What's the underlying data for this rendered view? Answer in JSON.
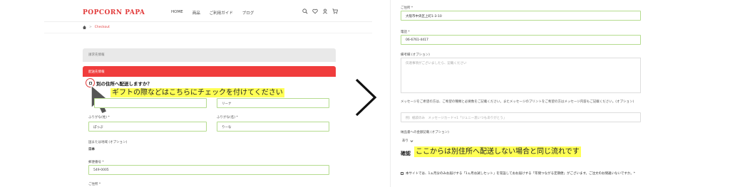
{
  "left": {
    "logo": "POPCORN PAPA",
    "nav": [
      "HOME",
      "商品",
      "ご利用ガイド",
      "ブログ"
    ],
    "breadcrumb": {
      "separator": ">",
      "current": "Checkout"
    },
    "section_customer": "請求先情報",
    "section_shipping": "配送先情報",
    "ship_diff_label": "別の住所へ配送しますか？",
    "callout": "ギフトの際などはこちらにチェックを付けてください",
    "fields": {
      "last_name_value": "",
      "first_name_value": "リーナ",
      "last_kana_label": "ふりがな(姓) *",
      "last_kana_value": "ぽっぷ",
      "first_kana_label": "ふりがな(名) *",
      "first_kana_value": "りーな",
      "country_label": "国または地域 (オプション)",
      "country_value": "日本",
      "postal_label": "郵便番号 *",
      "postal_value": "549-0005",
      "address_label": "ご住所 *"
    }
  },
  "right": {
    "address_label": "ご住所 *",
    "address_value": "大阪市中央区上町1-3-10",
    "phone_label": "電話 *",
    "phone_value": "06-6761-4417",
    "notes_label": "備考欄 (オプション)",
    "notes_placeholder": "伝達事項がございましたら、記載ください",
    "message_label": "メッセージをご希望の方は、ご希望の種類と必要数をご記載ください。またメッセージのプリントをご希望の方はメッセージ内容もご記載ください。(オプション)",
    "message_placeholder": "例）紙袋のみ　メッセージカード+1「ジュニー思いつもありがとう」",
    "receipt_label": "納品書への金額記載 (オプション)",
    "receipt_value": "あり",
    "confirm_label": "確認",
    "callout": "ここからは別住所へ配送しない場合と同じ流れです",
    "agree_text": "本サイトでは、1ヵ月分のみお届けする「1ヵ月お試しセット」を常設しておお届けする「年間つながる定期便」がございます。ご注文のお間違いないですか。*"
  }
}
